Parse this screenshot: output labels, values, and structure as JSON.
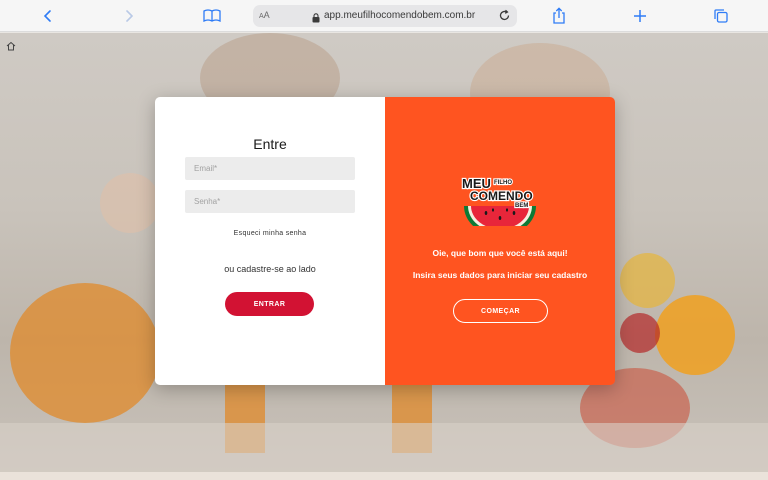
{
  "browser": {
    "text_size_label": "AA",
    "url": "app.meufilhocomendobem.com.br"
  },
  "login": {
    "title": "Entre",
    "email_placeholder": "Email*",
    "password_placeholder": "Senha*",
    "forgot_link": "Esqueci minha senha",
    "or_text": "ou cadastre-se ao lado",
    "submit_label": "ENTRAR"
  },
  "signup": {
    "logo_text": [
      "MEU",
      "FILHO",
      "COMENDO",
      "BEM"
    ],
    "greeting": "Oie, que bom que você está aqui!",
    "subtitle": "Insira seus dados para iniciar seu cadastro",
    "start_label": "COMEÇAR"
  },
  "colors": {
    "accent": "#ff5420",
    "primary_button": "#d21233",
    "browser_blue": "#2f7cf6"
  }
}
